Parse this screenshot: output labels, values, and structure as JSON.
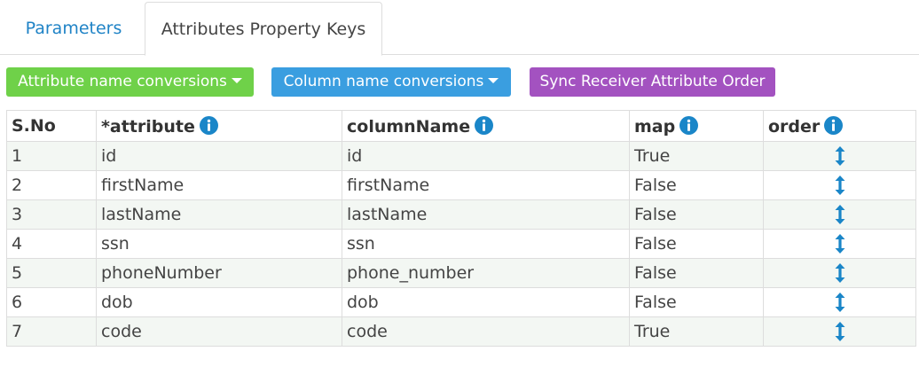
{
  "tabs": [
    {
      "label": "Parameters",
      "active": false
    },
    {
      "label": "Attributes Property Keys",
      "active": true
    }
  ],
  "toolbar": {
    "attribute_conversions_label": "Attribute name conversions",
    "column_conversions_label": "Column name conversions",
    "sync_label": "Sync Receiver Attribute Order"
  },
  "table": {
    "columns": [
      "S.No",
      "*attribute",
      "columnName",
      "map",
      "order"
    ],
    "rows": [
      {
        "sno": "1",
        "attribute": "id",
        "columnName": "id",
        "map": "True"
      },
      {
        "sno": "2",
        "attribute": "firstName",
        "columnName": "firstName",
        "map": "False"
      },
      {
        "sno": "3",
        "attribute": "lastName",
        "columnName": "lastName",
        "map": "False"
      },
      {
        "sno": "4",
        "attribute": "ssn",
        "columnName": "ssn",
        "map": "False"
      },
      {
        "sno": "5",
        "attribute": "phoneNumber",
        "columnName": "phone_number",
        "map": "False"
      },
      {
        "sno": "6",
        "attribute": "dob",
        "columnName": "dob",
        "map": "False"
      },
      {
        "sno": "7",
        "attribute": "code",
        "columnName": "code",
        "map": "True"
      }
    ]
  },
  "colors": {
    "link_blue": "#1f83c6",
    "info_icon": "#1a86c8",
    "button_green": "#6fd149",
    "button_blue": "#3a9ee0",
    "button_purple": "#a352c0",
    "row_stripe": "#f3f7f3"
  },
  "icons": {
    "info": "info-circle-icon",
    "order": "vertical-resize-arrows-icon",
    "dropdown": "caret-down-icon"
  }
}
